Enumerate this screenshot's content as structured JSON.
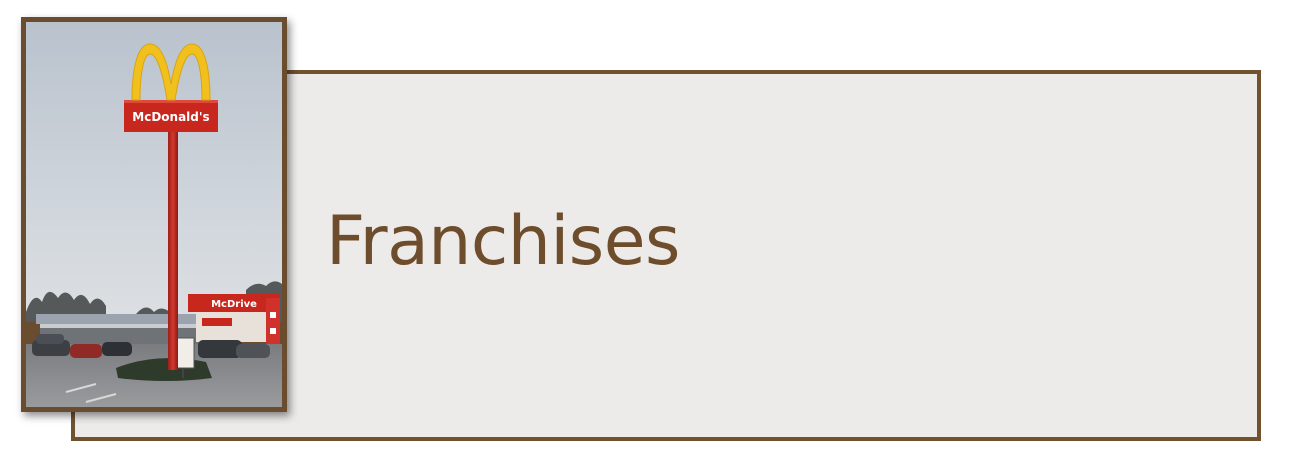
{
  "slide": {
    "title": "Franchises"
  },
  "photo": {
    "subject": "mcdonalds-sign-photo",
    "sign_text": "McDonald's",
    "secondary_sign_text": "McDrive"
  },
  "colors": {
    "frame": "#70522f",
    "title": "#6d4d2b",
    "box_fill": "#edebea",
    "sign_red": "#c8271e",
    "arches_yellow": "#f2c01d"
  }
}
